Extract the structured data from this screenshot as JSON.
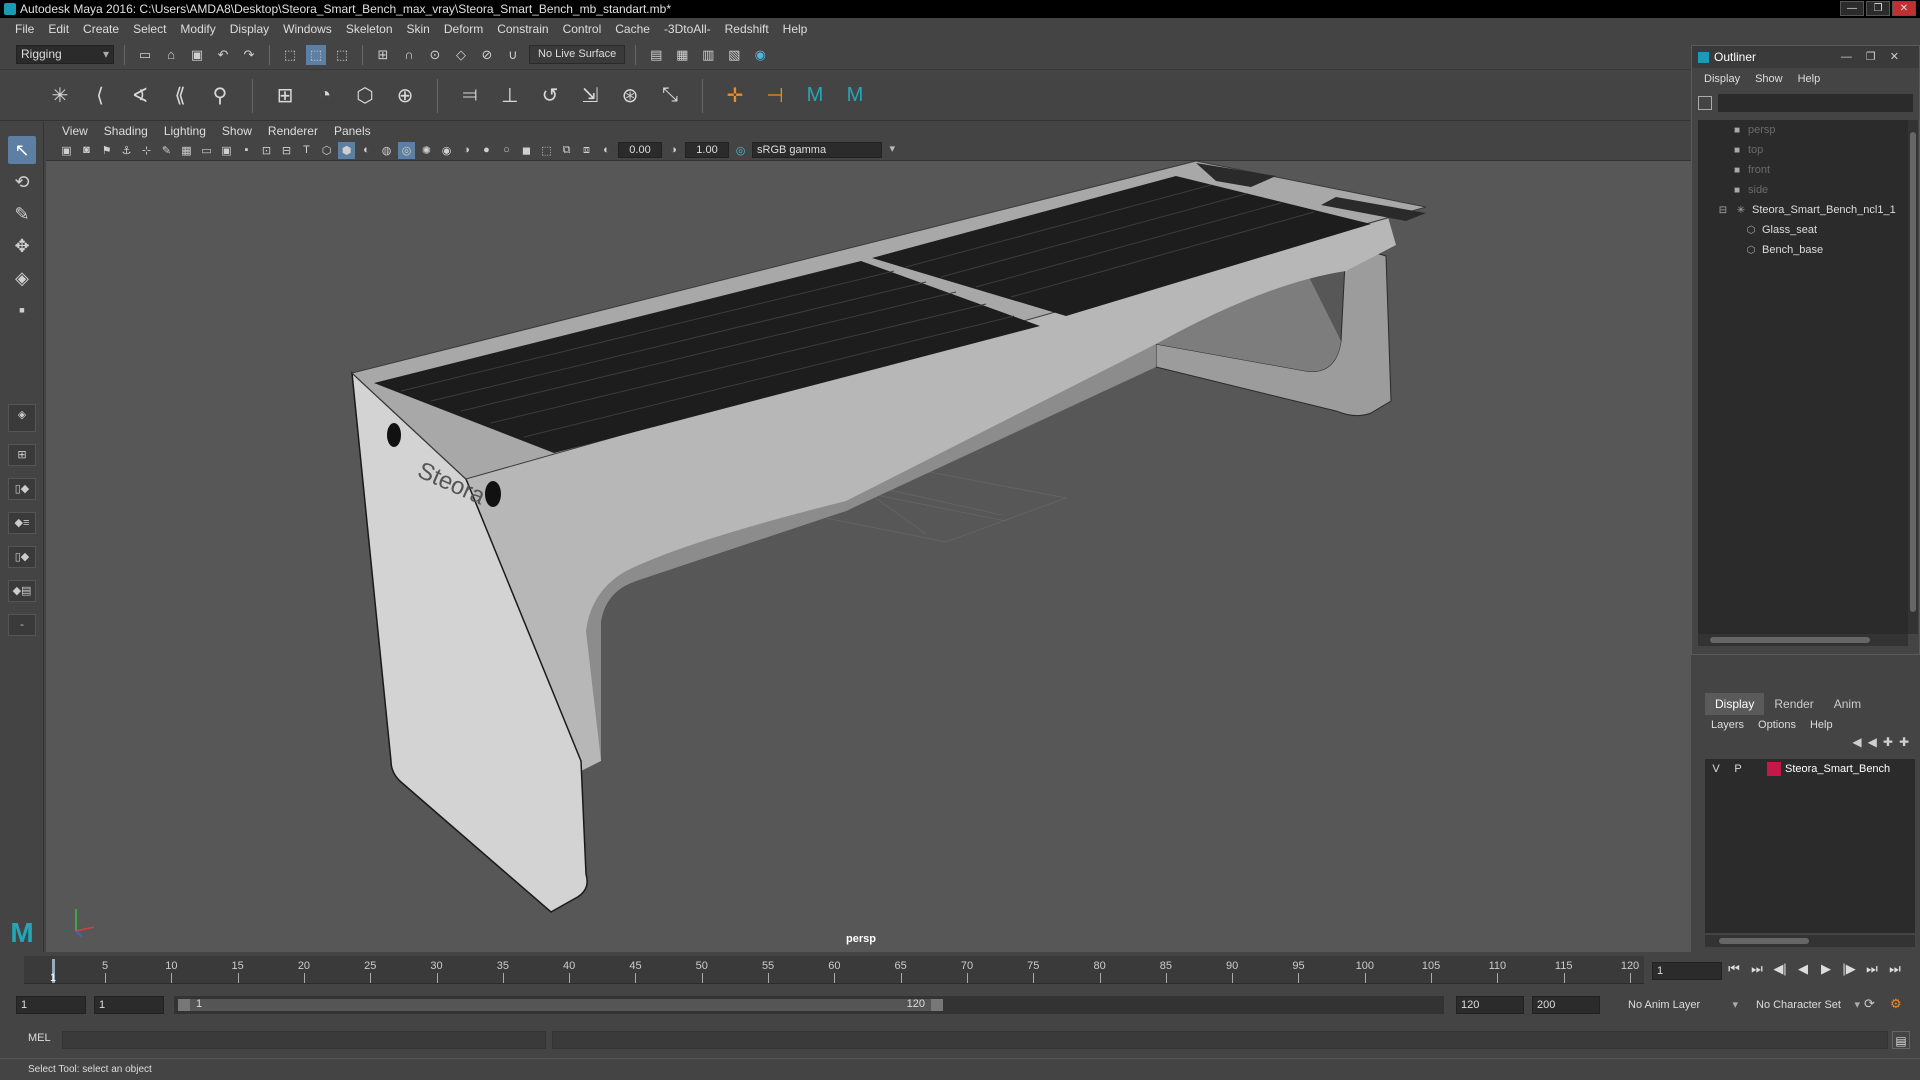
{
  "window": {
    "title": "Autodesk Maya 2016: C:\\Users\\AMDA8\\Desktop\\Steora_Smart_Bench_max_vray\\Steora_Smart_Bench_mb_standart.mb*",
    "minimize": "—",
    "maximize": "❐",
    "close": "✕"
  },
  "menubar": [
    "File",
    "Edit",
    "Create",
    "Select",
    "Modify",
    "Display",
    "Windows",
    "Skeleton",
    "Skin",
    "Deform",
    "Constrain",
    "Control",
    "Cache",
    "-3DtoAll-",
    "Redshift",
    "Help"
  ],
  "toolbar": {
    "menu_set": "Rigging",
    "live_surface": "No Live Surface"
  },
  "panel": {
    "menus": [
      "View",
      "Shading",
      "Lighting",
      "Show",
      "Renderer",
      "Panels"
    ],
    "exposure": "0.00",
    "gamma_value": "1.00",
    "color_space": "sRGB gamma",
    "camera_label": "persp"
  },
  "model": {
    "brand_text": "Steora"
  },
  "outliner": {
    "title": "Outliner",
    "menus": [
      "Display",
      "Show",
      "Help"
    ],
    "items": [
      {
        "label": "persp",
        "type": "camera"
      },
      {
        "label": "top",
        "type": "camera"
      },
      {
        "label": "front",
        "type": "camera"
      },
      {
        "label": "side",
        "type": "camera"
      },
      {
        "label": "Steora_Smart_Bench_ncl1_1",
        "type": "group"
      },
      {
        "label": "Glass_seat",
        "type": "mesh"
      },
      {
        "label": "Bench_base",
        "type": "mesh"
      }
    ]
  },
  "layers": {
    "tabs": [
      "Display",
      "Render",
      "Anim"
    ],
    "active_tab": "Display",
    "menus": [
      "Layers",
      "Options",
      "Help"
    ],
    "rows": [
      {
        "v": "V",
        "p": "P",
        "name": "Steora_Smart_Bench",
        "color": "#c4184a"
      }
    ]
  },
  "timeline": {
    "ticks": [
      "5",
      "10",
      "15",
      "20",
      "25",
      "30",
      "35",
      "40",
      "45",
      "50",
      "55",
      "60",
      "65",
      "70",
      "75",
      "80",
      "85",
      "90",
      "95",
      "100",
      "105",
      "110",
      "115",
      "120"
    ],
    "current_frame": "1",
    "current_field": "1"
  },
  "range": {
    "start_time": "1",
    "playback_start": "1",
    "slider_start": "1",
    "slider_end": "120",
    "playback_end": "120",
    "end_time": "200",
    "anim_layer": "No Anim Layer",
    "character_set": "No Character Set"
  },
  "command": {
    "mel_label": "MEL"
  },
  "helpline": {
    "text": "Select Tool: select an object"
  },
  "colors": {
    "maya_teal": "#1a9bb5",
    "layer_red": "#c4184a",
    "shelf_orange": "#f08a24",
    "active_blue": "#5d7fa3"
  }
}
